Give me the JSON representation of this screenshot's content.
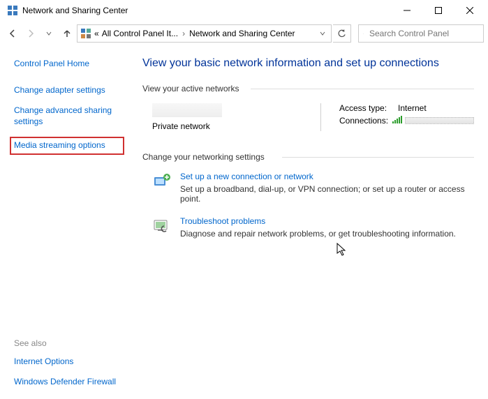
{
  "window": {
    "title": "Network and Sharing Center"
  },
  "toolbar": {
    "breadcrumb_pre": "«",
    "breadcrumb1": "All Control Panel It...",
    "breadcrumb2": "Network and Sharing Center",
    "search_placeholder": "Search Control Panel"
  },
  "sidebar": {
    "home": "Control Panel Home",
    "links": [
      "Change adapter settings",
      "Change advanced sharing settings",
      "Media streaming options"
    ],
    "see_also_label": "See also",
    "see_also": [
      "Internet Options",
      "Windows Defender Firewall"
    ]
  },
  "main": {
    "title": "View your basic network information and set up connections",
    "active_hdr": "View your active networks",
    "net_type": "Private network",
    "access_key": "Access type:",
    "access_val": "Internet",
    "conn_key": "Connections:",
    "change_hdr": "Change your networking settings",
    "item1_link": "Set up a new connection or network",
    "item1_desc": "Set up a broadband, dial-up, or VPN connection; or set up a router or access point.",
    "item2_link": "Troubleshoot problems",
    "item2_desc": "Diagnose and repair network problems, or get troubleshooting information."
  }
}
